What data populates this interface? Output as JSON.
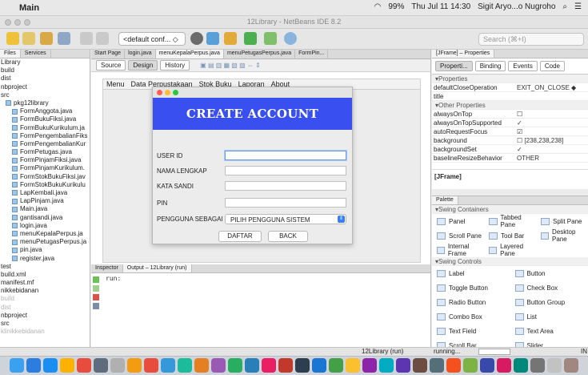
{
  "menubar": {
    "app_name": "Main",
    "battery": "99%",
    "datetime": "Thu Jul 11  14:30",
    "user": "Sigit Aryo...o Nugroho"
  },
  "window": {
    "title": "12Library - NetBeans IDE 8.2"
  },
  "toolbar": {
    "config_value": "<default conf... ◇",
    "search_placeholder": "Search (⌘+I)"
  },
  "left_panel": {
    "tabs": [
      "Files",
      "Services"
    ],
    "tree": [
      {
        "label": "Library",
        "dim": false
      },
      {
        "label": "build",
        "dim": false
      },
      {
        "label": "dist",
        "dim": false
      },
      {
        "label": "nbproject",
        "dim": false
      },
      {
        "label": "src",
        "dim": false
      },
      {
        "label": "pkg12library",
        "dim": false
      },
      {
        "label": "FormAnggota.java",
        "dim": false
      },
      {
        "label": "FormBukuFiksi.java",
        "dim": false
      },
      {
        "label": "FormBukuKurikulum.ja",
        "dim": false
      },
      {
        "label": "FormPengembalianFiks",
        "dim": false
      },
      {
        "label": "FormPengembalianKur",
        "dim": false
      },
      {
        "label": "FormPetugas.java",
        "dim": false
      },
      {
        "label": "FormPinjamFiksi.java",
        "dim": false
      },
      {
        "label": "FormPinjamKurikulum.",
        "dim": false
      },
      {
        "label": "FormStokBukuFiksi.jav",
        "dim": false
      },
      {
        "label": "FormStokBukuKurikulu",
        "dim": false
      },
      {
        "label": "LapKembali.java",
        "dim": false
      },
      {
        "label": "LapPinjam.java",
        "dim": false
      },
      {
        "label": "Main.java",
        "dim": false
      },
      {
        "label": "gantisandi.java",
        "dim": false
      },
      {
        "label": "login.java",
        "dim": false
      },
      {
        "label": "menuKepalaPerpus.ja",
        "dim": false
      },
      {
        "label": "menuPetugasPerpus.ja",
        "dim": false
      },
      {
        "label": "pin.java",
        "dim": false
      },
      {
        "label": "register.java",
        "dim": false
      },
      {
        "label": "test",
        "dim": false
      },
      {
        "label": "build.xml",
        "dim": false
      },
      {
        "label": "manifest.mf",
        "dim": false
      },
      {
        "label": "nikkebidanan",
        "dim": false
      },
      {
        "label": "build",
        "dim": true
      },
      {
        "label": "dist",
        "dim": true
      },
      {
        "label": "nbproject",
        "dim": false
      },
      {
        "label": "src",
        "dim": false
      },
      {
        "label": "klinikkebidanan",
        "dim": true
      }
    ]
  },
  "editor": {
    "tabs": [
      "Start Page",
      "login.java",
      "menuKepalaPerpus.java",
      "menuPetugasPerpus.java",
      "FormPin..."
    ],
    "active_tab": 2,
    "view_source": "Source",
    "view_design": "Design",
    "view_history": "History",
    "form_menu": [
      "Menu",
      "Data Perpustakaan",
      "Stok Buku",
      "Laporan",
      "About"
    ]
  },
  "dialog": {
    "heading": "CREATE ACCOUNT",
    "banner_color": "#3a4ff0",
    "fields": [
      {
        "label": "USER ID",
        "focused": true
      },
      {
        "label": "NAMA LENGKAP",
        "focused": false
      },
      {
        "label": "KATA SANDI",
        "focused": false
      },
      {
        "label": "PIN",
        "focused": false
      }
    ],
    "role_label": "PENGGUNA SEBAGAI",
    "role_value": "PILIH PENGGUNA SISTEM",
    "submit_label": "DAFTAR",
    "back_label": "BACK"
  },
  "output": {
    "tabs": [
      "Inspector",
      "Output – 12Library (run)"
    ],
    "line": "run:"
  },
  "properties": {
    "title": "[JFrame] – Properties",
    "tabs": [
      "Properti...",
      "Binding",
      "Events",
      "Code"
    ],
    "section1": "Properties",
    "rows1": [
      {
        "k": "defaultCloseOperation",
        "v": "EXIT_ON_CLOSE  ◆"
      },
      {
        "k": "title",
        "v": ""
      }
    ],
    "section2": "Other Properties",
    "rows2": [
      {
        "k": "alwaysOnTop",
        "v": "☐"
      },
      {
        "k": "alwaysOnTopSupported",
        "v": "✓"
      },
      {
        "k": "autoRequestFocus",
        "v": "☑"
      },
      {
        "k": "background",
        "v": "☐ [238,238,238]"
      },
      {
        "k": "backgroundSet",
        "v": "✓"
      },
      {
        "k": "baselineResizeBehavior",
        "v": "OTHER"
      }
    ],
    "help_title": "[JFrame]"
  },
  "palette": {
    "title": "Palette",
    "section1": "Swing Containers",
    "containers": [
      [
        "Panel",
        "Tabbed Pane",
        "Split Pane"
      ],
      [
        "Scroll Pane",
        "Tool Bar",
        "Desktop Pane"
      ],
      [
        "Internal Frame",
        "Layered Pane",
        ""
      ]
    ],
    "section2": "Swing Controls",
    "controls": [
      [
        "Label",
        "Button"
      ],
      [
        "Toggle Button",
        "Check Box"
      ],
      [
        "Radio Button",
        "Button Group"
      ],
      [
        "Combo Box",
        "List"
      ],
      [
        "Text Field",
        "Text Area"
      ],
      [
        "Scroll Bar",
        "Slider"
      ]
    ]
  },
  "status": {
    "project": "12Library (run)",
    "state": "running...",
    "mode": "IN"
  },
  "dock_colors": [
    "#3aa0f0",
    "#2b7de0",
    "#1b8ff0",
    "#ffb100",
    "#e84c3d",
    "#5d6d7e",
    "#b0b0b0",
    "#f39c12",
    "#e74c3c",
    "#3498db",
    "#1abc9c",
    "#e67e22",
    "#9b59b6",
    "#27ae60",
    "#2980b9",
    "#e91e63",
    "#c0392b",
    "#2c3e50",
    "#1976d2",
    "#43a047",
    "#fbc02d",
    "#8e24aa",
    "#00acc1",
    "#5e35b1",
    "#6d4c41",
    "#546e7a",
    "#f4511e",
    "#7cb342",
    "#3949ab",
    "#d81b60",
    "#00897b",
    "#757575",
    "#c2c2c2",
    "#a1887f"
  ]
}
